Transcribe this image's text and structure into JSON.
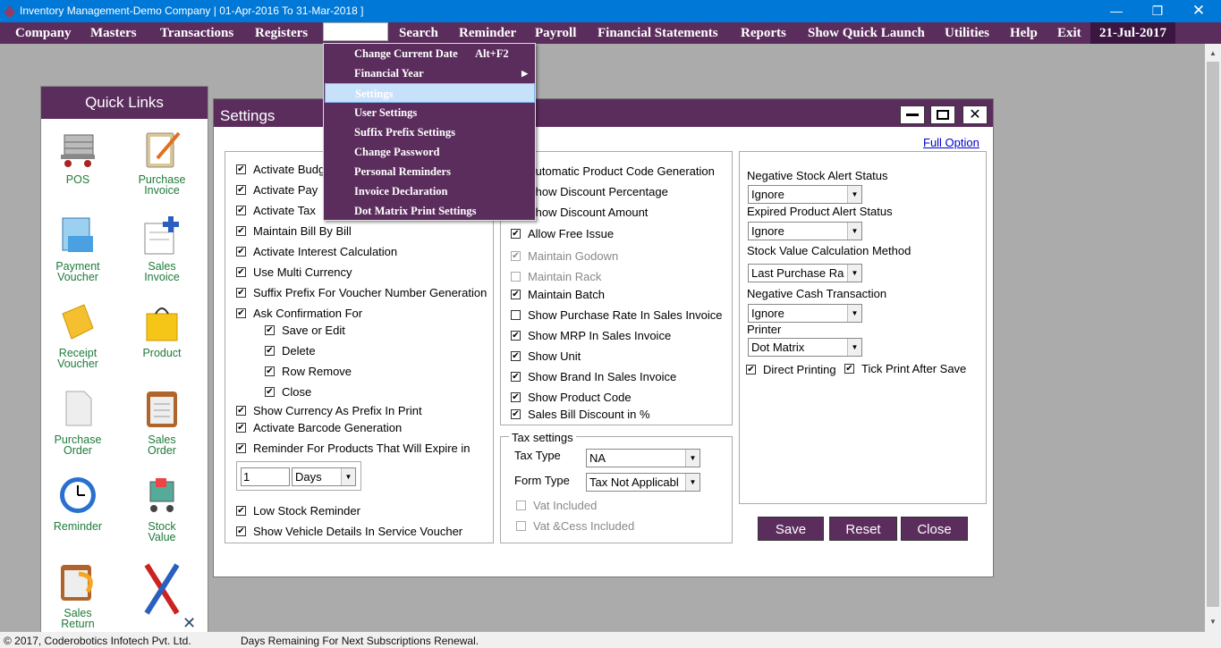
{
  "titlebar": {
    "title": "Inventory Management-Demo Company | 01-Apr-2016 To 31-Mar-2018 ]"
  },
  "menu": {
    "items": [
      "Company",
      "Masters",
      "Transactions",
      "Registers",
      "Settings",
      "Search",
      "Reminder",
      "Payroll",
      "Financial Statements",
      "Reports",
      "Show Quick Launch",
      "Utilities",
      "Help",
      "Exit"
    ],
    "date": "21-Jul-2017"
  },
  "dropdown": {
    "items": [
      "Change Current Date",
      "Financial Year",
      "Settings",
      "User Settings",
      "Suffix Prefix Settings",
      "Change Password",
      "Personal Reminders",
      "Invoice Declaration",
      "Dot Matrix Print Settings"
    ],
    "shortcut": "Alt+F2",
    "highlighted": "Settings"
  },
  "quick_links": {
    "title": "Quick Links",
    "items": [
      {
        "label": "POS",
        "icon": "cart-icon"
      },
      {
        "label": "Purchase Invoice",
        "icon": "clipboard-pencil-icon"
      },
      {
        "label": "Payment Voucher",
        "icon": "voucher-icon"
      },
      {
        "label": "Sales Invoice",
        "icon": "invoice-icon"
      },
      {
        "label": "Receipt Voucher",
        "icon": "receipt-icon"
      },
      {
        "label": "Product",
        "icon": "bag-icon"
      },
      {
        "label": "Purchase Order",
        "icon": "document-icon"
      },
      {
        "label": "Sales Order",
        "icon": "clipboard-icon"
      },
      {
        "label": "Reminder",
        "icon": "clock-icon"
      },
      {
        "label": "Stock Value",
        "icon": "stock-cart-icon"
      },
      {
        "label": "Sales Return",
        "icon": "return-icon"
      },
      {
        "label": "",
        "icon": "tools-icon"
      }
    ]
  },
  "settings": {
    "title": "Settings",
    "full_option": "Full Option",
    "col1": [
      {
        "label": "Activate Budget",
        "checked": true
      },
      {
        "label": "Activate Pay",
        "checked": true
      },
      {
        "label": "Activate Tax",
        "checked": true
      },
      {
        "label": "Maintain Bill By Bill",
        "checked": true
      },
      {
        "label": "Activate Interest Calculation",
        "checked": true
      },
      {
        "label": "Use Multi Currency",
        "checked": true
      },
      {
        "label": "Suffix Prefix For Voucher Number Generation",
        "checked": true
      },
      {
        "label": "Ask Confirmation For",
        "checked": true
      }
    ],
    "confirm": [
      {
        "label": "Save or Edit",
        "checked": true
      },
      {
        "label": "Delete",
        "checked": true
      },
      {
        "label": "Row Remove",
        "checked": true
      },
      {
        "label": "Close",
        "checked": true
      }
    ],
    "col1b": [
      {
        "label": "Show Currency As Prefix In Print",
        "checked": true
      },
      {
        "label": "Activate Barcode Generation",
        "checked": true
      },
      {
        "label": "Reminder For Products That Will Expire in",
        "checked": true
      }
    ],
    "expire_value": "1",
    "expire_unit": "Days",
    "col1c": [
      {
        "label": "Low Stock Reminder",
        "checked": true
      },
      {
        "label": "Show Vehicle Details In Service Voucher",
        "checked": true
      }
    ],
    "col2": [
      {
        "label": "Automatic Product Code Generation",
        "checked": true,
        "disabled": false
      },
      {
        "label": "Show Discount Percentage",
        "checked": true,
        "disabled": false
      },
      {
        "label": "Show Discount Amount",
        "checked": true,
        "disabled": false
      },
      {
        "label": "Allow Free Issue",
        "checked": true,
        "disabled": false
      },
      {
        "label": "Maintain Godown",
        "checked": true,
        "disabled": true
      },
      {
        "label": "Maintain Rack",
        "checked": false,
        "disabled": true
      },
      {
        "label": "Maintain Batch",
        "checked": true,
        "disabled": false
      },
      {
        "label": "Show Purchase Rate In Sales Invoice",
        "checked": false,
        "disabled": false
      },
      {
        "label": "Show MRP In Sales Invoice",
        "checked": true,
        "disabled": false
      },
      {
        "label": "Show Unit",
        "checked": true,
        "disabled": false
      },
      {
        "label": "Show Brand In Sales Invoice",
        "checked": true,
        "disabled": false
      },
      {
        "label": "Show Product Code",
        "checked": true,
        "disabled": false
      },
      {
        "label": "Sales Bill Discount in %",
        "checked": true,
        "disabled": false
      }
    ],
    "tax": {
      "legend": "Tax settings",
      "tax_type_label": "Tax Type",
      "tax_type": "NA",
      "form_type_label": "Form Type",
      "form_type": "Tax Not Applicabl",
      "vat_included": "Vat Included",
      "vat_cess_included": "Vat &Cess Included"
    },
    "col3": {
      "neg_stock_label": "Negative Stock Alert Status",
      "neg_stock": "Ignore",
      "expired_label": "Expired Product Alert Status",
      "expired": "Ignore",
      "stock_method_label": "Stock Value Calculation  Method",
      "stock_method": "Last Purchase Ra",
      "neg_cash_label": "Negative Cash Transaction",
      "neg_cash": "Ignore",
      "printer_label": "Printer",
      "printer": "Dot Matrix",
      "direct_printing": "Direct Printing",
      "tick_print": "Tick Print After Save"
    },
    "buttons": {
      "save": "Save",
      "reset": "Reset",
      "close": "Close"
    }
  },
  "status": {
    "copyright": "© 2017, Coderobotics Infotech Pvt. Ltd.",
    "renewal": "Days Remaining For Next Subscriptions Renewal."
  },
  "colors": {
    "brand": "#5b2d5d",
    "titlebar": "#0078d7",
    "quicklink_text": "#1e7b3a"
  }
}
